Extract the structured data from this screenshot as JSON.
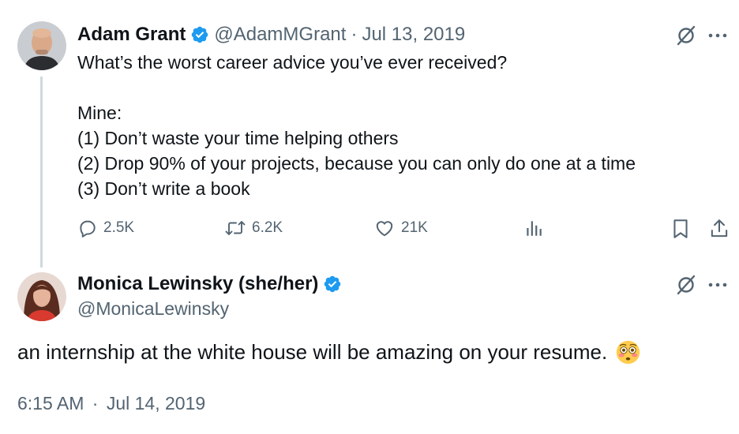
{
  "tweet": {
    "author": {
      "display_name": "Adam Grant",
      "handle": "@AdamMGrant",
      "separator": "·",
      "date": "Jul 13, 2019",
      "avatar_icon": "person-avatar-bald-man",
      "verified_icon": "verified-badge-icon"
    },
    "lines": [
      "What’s the worst career advice you’ve ever received?",
      "",
      "Mine:",
      "(1) Don’t waste your time helping others",
      "(2) Drop 90% of your projects, because you can only do one at a time",
      "(3) Don’t write a book"
    ],
    "actions": {
      "replies": "2.5K",
      "retweets": "6.2K",
      "likes": "21K"
    }
  },
  "reply": {
    "author": {
      "display_name": "Monica Lewinsky (she/her)",
      "handle": "@MonicaLewinsky",
      "avatar_icon": "person-avatar-woman",
      "verified_icon": "verified-badge-icon"
    },
    "text": "an internship at the white house will be amazing on your resume.",
    "emoji": "flushed-face-emoji",
    "time": "6:15 AM",
    "separator": "·",
    "date": "Jul 14, 2019"
  },
  "colors": {
    "text": "#0f1419",
    "muted": "#536471",
    "verified": "#1d9bf0",
    "thread_line": "#cfd9de"
  }
}
